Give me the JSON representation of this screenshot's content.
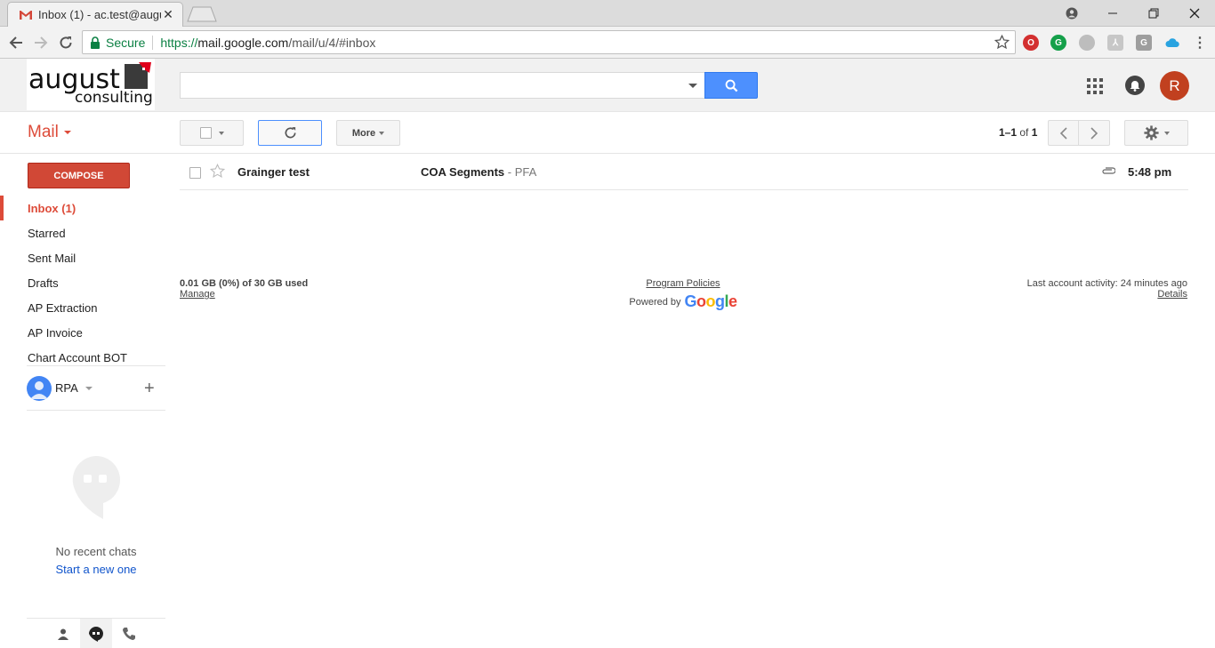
{
  "browser": {
    "tab_title": "Inbox (1) - ac.test@augus",
    "url_secure_label": "Secure",
    "url_scheme": "https://",
    "url_host": "mail.google.com",
    "url_path": "/mail/u/4/#inbox"
  },
  "header": {
    "logo_line1": "august",
    "logo_line2": "consulting",
    "search_value": "",
    "avatar_letter": "R"
  },
  "actionbar": {
    "mail_label": "Mail",
    "more_label": "More",
    "pager_range": "1–1",
    "pager_of": "of",
    "pager_total": "1"
  },
  "sidebar": {
    "compose_label": "COMPOSE",
    "items": [
      {
        "label": "Inbox (1)",
        "active": true
      },
      {
        "label": "Starred"
      },
      {
        "label": "Sent Mail"
      },
      {
        "label": "Drafts"
      },
      {
        "label": "AP Extraction"
      },
      {
        "label": "AP Invoice"
      },
      {
        "label": "Chart Account BOT"
      }
    ],
    "hangouts_user": "RPA",
    "no_chats": "No recent chats",
    "start_new": "Start a new one"
  },
  "emails": [
    {
      "sender": "Grainger test",
      "subject": "COA Segments",
      "snippet": " - PFA",
      "time": "5:48 pm",
      "has_attachment": true
    }
  ],
  "footer": {
    "storage": "0.01 GB (0%) of 30 GB used",
    "manage": "Manage",
    "program_policies": "Program Policies",
    "powered_by": "Powered by",
    "google_word": "Google",
    "activity": "Last account activity: 24 minutes ago",
    "details": "Details"
  },
  "colors": {
    "accent_red": "#dd4b39",
    "compose_red": "#d14836",
    "search_blue": "#4d90fe",
    "link_blue": "#15c"
  }
}
